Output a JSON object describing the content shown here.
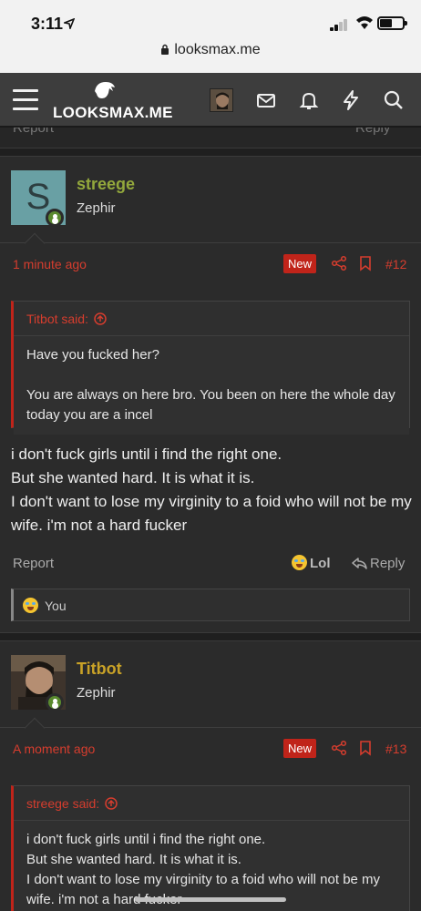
{
  "status_bar": {
    "time": "3:11",
    "url": "looksmax.me"
  },
  "header": {
    "logo_text": "LOOKSMAX.ME"
  },
  "prev_cutoff": {
    "report": "Report",
    "reply": "Reply"
  },
  "posts": [
    {
      "username": "streege",
      "avatar_letter": "S",
      "user_title": "Zephir",
      "time_ago": "1 minute ago",
      "badge": "New",
      "post_number": "#12",
      "quote_author": "Titbot said:",
      "quote_lines": [
        "Have you fucked her?",
        "You are always on here bro. You been on here the whole day today you are a incel"
      ],
      "message_lines": [
        "i don't fuck girls until i find the right one.",
        "But she wanted hard. It is what it is.",
        "I don't want to lose my virginity to a foid who will not be my wife. i'm not a hard fucker"
      ],
      "report_label": "Report",
      "reaction_label": "Lol",
      "reply_label": "Reply",
      "reacted_by": "You"
    },
    {
      "username": "Titbot",
      "user_title": "Zephir",
      "time_ago": "A moment ago",
      "badge": "New",
      "post_number": "#13",
      "quote_author": "streege said:",
      "quote_lines": [
        "i don't fuck girls until i find the right one.",
        "But she wanted hard. It is what it is.",
        "I don't want to lose my virginity to a foid who will not be my wife. i'm not a hard fucker"
      ]
    }
  ],
  "colors": {
    "accent_red": "#d63d2e",
    "badge_red": "#c0241a",
    "username_green": "#93a83c",
    "username_gold": "#c9a227"
  },
  "icons": [
    "hamburger-icon",
    "mail-icon",
    "bell-icon",
    "bolt-icon",
    "search-icon",
    "share-icon",
    "bookmark-icon",
    "reply-icon",
    "arrow-up-circle-icon",
    "lock-icon"
  ]
}
